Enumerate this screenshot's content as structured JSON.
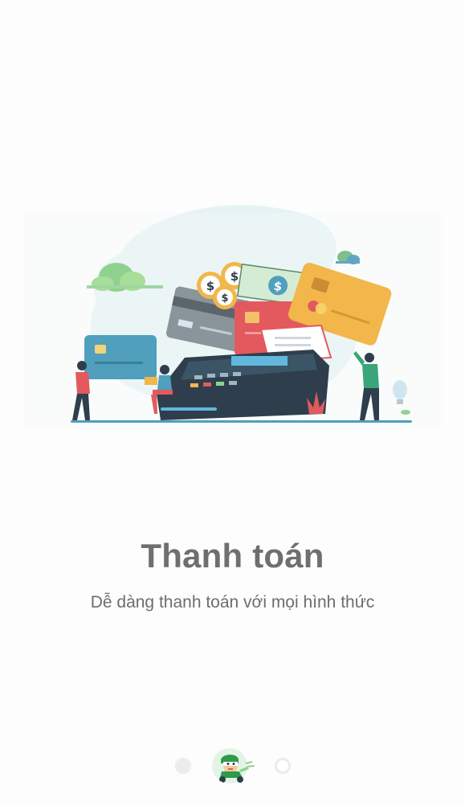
{
  "onboarding": {
    "title": "Thanh toán",
    "subtitle": "Dễ dàng thanh toán với mọi hình thức"
  },
  "illustration": {
    "card_symbol_1": "$",
    "card_symbol_2": "$",
    "card_symbol_3": "$",
    "card_symbol_4": "$"
  },
  "pager": {
    "total_pages": 3,
    "current_page": 2,
    "active_indicator_icon": "scooter-mascot-icon"
  },
  "colors": {
    "title": "#6f6f6f",
    "subtitle": "#6d6d6d",
    "dot_inactive": "#ececec",
    "mascot_green": "#2e9b4a",
    "card_teal": "#4f9fbd",
    "card_red": "#e3595e",
    "card_yellow": "#f2b64a",
    "card_gray": "#8a949b",
    "terminal_dark": "#2e3e4c"
  }
}
